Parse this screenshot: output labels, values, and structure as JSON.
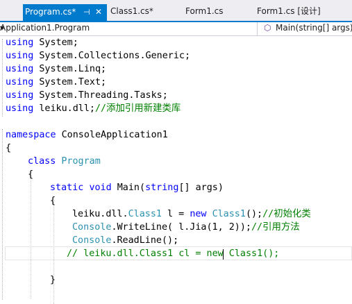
{
  "tabs": [
    {
      "label": "Program.cs*",
      "pin": "⊣",
      "close": "✕"
    },
    {
      "label": "Class1.cs*"
    },
    {
      "label": "Form1.cs"
    },
    {
      "label": "Form1.cs [设计]"
    }
  ],
  "navbar": {
    "left": "Application1.Program",
    "right": "Main(string[] args)",
    "right_icon": "method-icon"
  },
  "code": {
    "l1": {
      "k": "using",
      "t": " System;"
    },
    "l2": {
      "k": "using",
      "t": " System.Collections.Generic;"
    },
    "l3": {
      "k": "using",
      "t": " System.Linq;"
    },
    "l4": {
      "k": "using",
      "t": " System.Text;"
    },
    "l5": {
      "k": "using",
      "t": " System.Threading.Tasks;"
    },
    "l6": {
      "k": "using",
      "t": " leiku.dll;",
      "c": "//添加引用新建类库"
    },
    "l8": {
      "k": "namespace",
      "t": " ConsoleApplication1"
    },
    "l9": "{",
    "l10": {
      "k": "class",
      "ty": "Program"
    },
    "l11": "{",
    "l12": {
      "k1": "static",
      "k2": "void",
      "t1": " Main(",
      "k3": "string",
      "t2": "[] args)"
    },
    "l13": "{",
    "l14": {
      "t1": "leiku.dll.",
      "ty1": "Class1",
      "t2": " l = ",
      "k": "new",
      "ty2": "Class1",
      "t3": "();",
      "c": "//初始化类"
    },
    "l15": {
      "ty": "Console",
      "t1": ".WriteLine( l.Jia(1, 2));",
      "c": "//引用方法"
    },
    "l16": {
      "ty": "Console",
      "t": ".ReadLine();"
    },
    "l17": "// leiku.dll.Class1 cl = new Class1();",
    "l19": "}"
  }
}
